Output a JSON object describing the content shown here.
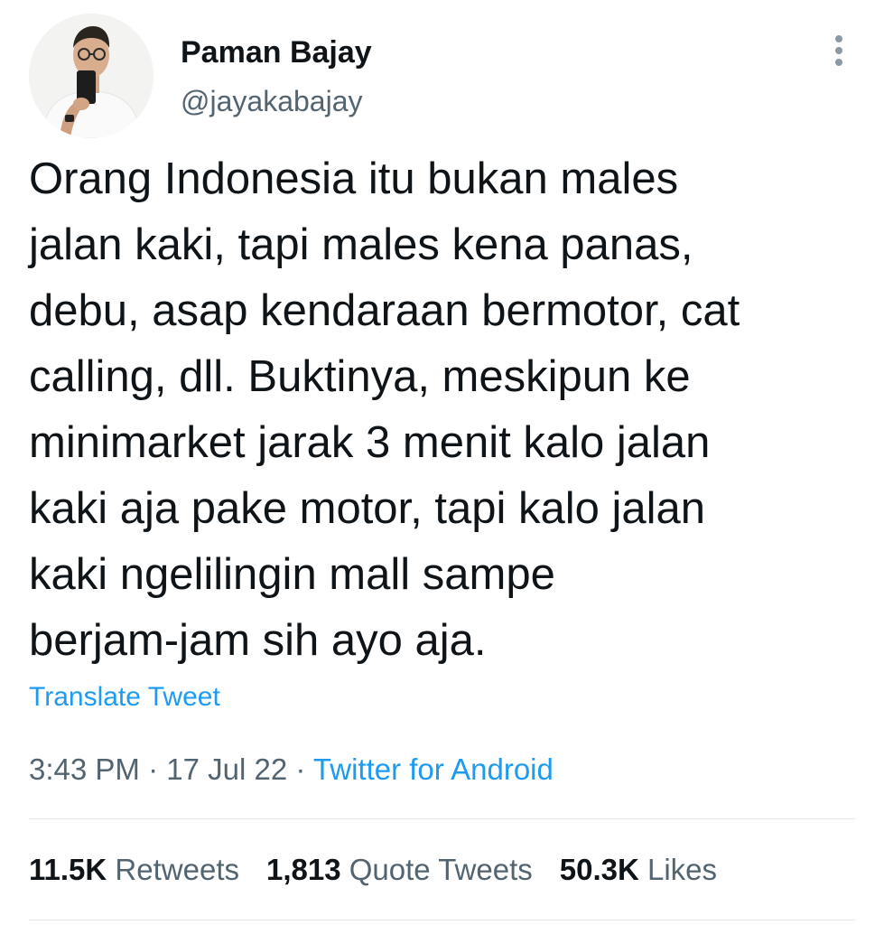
{
  "author": {
    "display_name": "Paman Bajay",
    "handle": "@jayakabajay"
  },
  "tweet": {
    "text": "Orang Indonesia itu bukan males\njalan kaki, tapi males kena panas,\ndebu, asap kendaraan bermotor, cat\ncalling, dll. Buktinya, meskipun ke\nminimarket jarak 3 menit kalo jalan\nkaki aja pake motor, tapi kalo jalan\nkaki ngelilingin mall sampe\nberjam-jam sih ayo aja.",
    "translate_label": "Translate Tweet"
  },
  "meta": {
    "time": "3:43 PM",
    "separator1": " · ",
    "date": "17 Jul 22",
    "separator2": " · ",
    "source": "Twitter for Android"
  },
  "stats": {
    "retweets": {
      "count": "11.5K",
      "label": "Retweets"
    },
    "quotes": {
      "count": "1,813",
      "label": "Quote Tweets"
    },
    "likes": {
      "count": "50.3K",
      "label": "Likes"
    }
  },
  "icons": {
    "more": "more-vertical-icon",
    "avatar": "profile-photo"
  },
  "colors": {
    "link": "#1d9bf0",
    "secondary_text": "#536471",
    "primary_text": "#0f1419",
    "divider": "#e1e6ea"
  }
}
